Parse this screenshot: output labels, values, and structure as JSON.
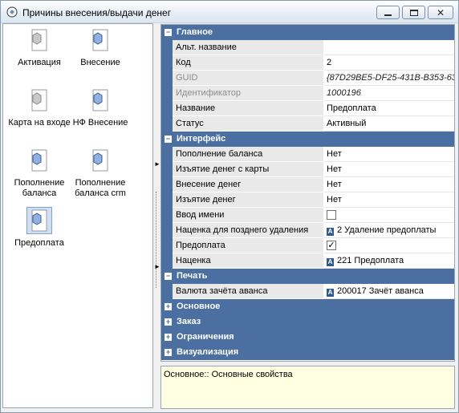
{
  "window": {
    "title": "Причины внесения/выдачи денег",
    "icon": "app-icon"
  },
  "left_panel": {
    "tiles": [
      {
        "label": "Активация",
        "icon": "grey-cube-icon",
        "selected": false
      },
      {
        "label": "Внесение",
        "icon": "blue-cube-icon",
        "selected": false
      },
      {
        "label": "Карта на входе",
        "icon": "grey-cube-icon",
        "selected": false
      },
      {
        "label": "НФ Внесение",
        "icon": "blue-cube-icon",
        "selected": false
      },
      {
        "label": "Пополнение баланса",
        "icon": "blue-cube-icon",
        "selected": false
      },
      {
        "label": "Пополнение баланса crm",
        "icon": "blue-cube-icon",
        "selected": false
      },
      {
        "label": "Предоплата",
        "icon": "blue-cube-icon",
        "selected": true
      }
    ]
  },
  "grid": {
    "main": {
      "title": "Главное",
      "rows": [
        {
          "name": "Альт. название",
          "value": ""
        },
        {
          "name": "Код",
          "value": "2"
        },
        {
          "name": "GUID",
          "value": "{87D29BE5-DF25-431B-B353-63"
        },
        {
          "name": "Идентификатор",
          "value": "1000196"
        },
        {
          "name": "Название",
          "value": "Предоплата"
        },
        {
          "name": "Статус",
          "value": "Активный"
        }
      ]
    },
    "interface": {
      "title": "Интерфейс",
      "rows": [
        {
          "name": "Пополнение баланса",
          "value": "Нет"
        },
        {
          "name": "Изъятие денег с карты",
          "value": "Нет"
        },
        {
          "name": "Внесение денег",
          "value": "Нет"
        },
        {
          "name": "Изъятие денег",
          "value": "Нет"
        },
        {
          "name": "Ввод имени",
          "value": ""
        },
        {
          "name": "Наценка для позднего удаления",
          "value": "2 Удаление предоплаты"
        },
        {
          "name": "Предоплата",
          "value": ""
        },
        {
          "name": "Наценка",
          "value": "221 Предоплата"
        }
      ],
      "checks": {
        "name_input": false,
        "prepay": true
      }
    },
    "print": {
      "title": "Печать",
      "rows": [
        {
          "name": "Валюта зачёта аванса",
          "value": "200017 Зачёт аванса"
        }
      ]
    },
    "collapsed": [
      "Основное",
      "Заказ",
      "Ограничения",
      "Визуализация"
    ]
  },
  "description": "Основное:: Основные свойства",
  "colors": {
    "category_bg": "#4a6fa0",
    "description_bg": "#ffffe1",
    "name_cell_bg": "#e9e9e9"
  }
}
